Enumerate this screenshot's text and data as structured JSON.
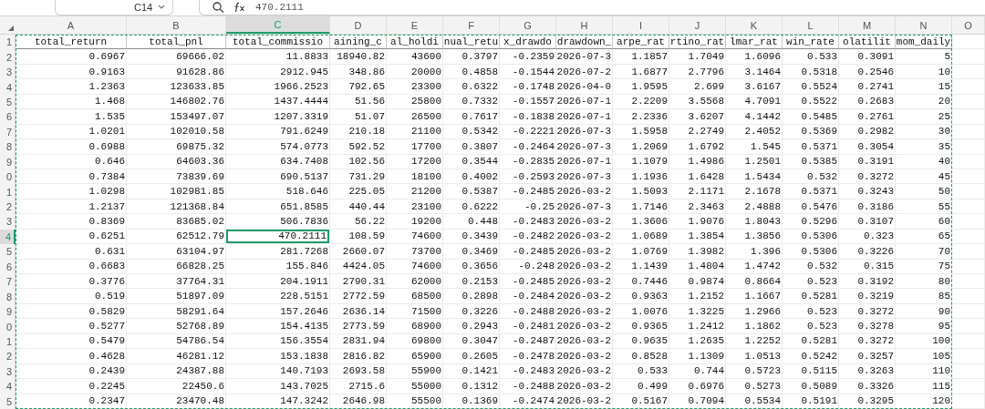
{
  "name_box": {
    "value": "C14"
  },
  "formula_bar": {
    "value": "470.2111"
  },
  "columns": [
    {
      "label": "A",
      "selected": false
    },
    {
      "label": "B",
      "selected": false
    },
    {
      "label": "C",
      "selected": true
    },
    {
      "label": "D",
      "selected": false
    },
    {
      "label": "E",
      "selected": false
    },
    {
      "label": "F",
      "selected": false
    },
    {
      "label": "G",
      "selected": false
    },
    {
      "label": "H",
      "selected": false
    },
    {
      "label": "I",
      "selected": false
    },
    {
      "label": "J",
      "selected": false
    },
    {
      "label": "K",
      "selected": false
    },
    {
      "label": "L",
      "selected": false
    },
    {
      "label": "M",
      "selected": false
    },
    {
      "label": "N",
      "selected": false
    },
    {
      "label": "O",
      "selected": false
    }
  ],
  "rows": [
    {
      "kind": "header",
      "label": "1",
      "selected": false,
      "cells": [
        "total_return",
        "total_pnl",
        "total_commissio",
        "aining_c",
        "al_holdi",
        "nual_retu",
        "x_drawdo",
        "drawdown_",
        "arpe_rat",
        "rtino_rat",
        "lmar_rat",
        "win_rate",
        "olatilit",
        "mom_daily"
      ]
    },
    {
      "kind": "data",
      "label": "2",
      "selected": false,
      "cells": [
        "0.6967",
        "69666.02",
        "11.8833",
        "18940.82",
        "43600",
        "0.3797",
        "-0.2359",
        "2026-07-3",
        "1.1857",
        "1.7049",
        "1.6096",
        "0.533",
        "0.3091",
        "5"
      ]
    },
    {
      "kind": "data",
      "label": "3",
      "selected": false,
      "cells": [
        "0.9163",
        "91628.86",
        "2912.945",
        "348.86",
        "20000",
        "0.4858",
        "-0.1544",
        "2026-07-2",
        "1.6877",
        "2.7796",
        "3.1464",
        "0.5318",
        "0.2546",
        "10"
      ]
    },
    {
      "kind": "data",
      "label": "4",
      "selected": false,
      "cells": [
        "1.2363",
        "123633.85",
        "1966.2523",
        "792.65",
        "23300",
        "0.6322",
        "-0.1748",
        "2026-04-0",
        "1.9595",
        "2.699",
        "3.6167",
        "0.5524",
        "0.2741",
        "15"
      ]
    },
    {
      "kind": "data",
      "label": "5",
      "selected": false,
      "cells": [
        "1.468",
        "146802.76",
        "1437.4444",
        "51.56",
        "25800",
        "0.7332",
        "-0.1557",
        "2026-07-1",
        "2.2209",
        "3.5568",
        "4.7091",
        "0.5522",
        "0.2683",
        "20"
      ]
    },
    {
      "kind": "data",
      "label": "6",
      "selected": false,
      "cells": [
        "1.535",
        "153497.07",
        "1207.3319",
        "51.07",
        "26500",
        "0.7617",
        "-0.1838",
        "2026-07-1",
        "2.2336",
        "3.6207",
        "4.1442",
        "0.5485",
        "0.2761",
        "25"
      ]
    },
    {
      "kind": "data",
      "label": "7",
      "selected": false,
      "cells": [
        "1.0201",
        "102010.58",
        "791.6249",
        "210.18",
        "21100",
        "0.5342",
        "-0.2221",
        "2026-07-3",
        "1.5958",
        "2.2749",
        "2.4052",
        "0.5369",
        "0.2982",
        "30"
      ]
    },
    {
      "kind": "data",
      "label": "8",
      "selected": false,
      "cells": [
        "0.6988",
        "69875.32",
        "574.0773",
        "592.52",
        "17700",
        "0.3807",
        "-0.2464",
        "2026-07-3",
        "1.2069",
        "1.6792",
        "1.545",
        "0.5371",
        "0.3054",
        "35"
      ]
    },
    {
      "kind": "data",
      "label": "9",
      "selected": false,
      "cells": [
        "0.646",
        "64603.36",
        "634.7408",
        "102.56",
        "17200",
        "0.3544",
        "-0.2835",
        "2026-07-1",
        "1.1079",
        "1.4986",
        "1.2501",
        "0.5385",
        "0.3191",
        "40"
      ]
    },
    {
      "kind": "data",
      "label": "0",
      "selected": false,
      "cells": [
        "0.7384",
        "73839.69",
        "690.5137",
        "731.29",
        "18100",
        "0.4002",
        "-0.2593",
        "2026-07-3",
        "1.1936",
        "1.6428",
        "1.5434",
        "0.532",
        "0.3272",
        "45"
      ]
    },
    {
      "kind": "data",
      "label": "1",
      "selected": false,
      "cells": [
        "1.0298",
        "102981.85",
        "518.646",
        "225.05",
        "21200",
        "0.5387",
        "-0.2485",
        "2026-03-2",
        "1.5093",
        "2.1171",
        "2.1678",
        "0.5371",
        "0.3243",
        "50"
      ]
    },
    {
      "kind": "data",
      "label": "2",
      "selected": false,
      "cells": [
        "1.2137",
        "121368.84",
        "651.8585",
        "440.44",
        "23100",
        "0.6222",
        "-0.25",
        "2026-07-3",
        "1.7146",
        "2.3463",
        "2.4888",
        "0.5476",
        "0.3186",
        "55"
      ]
    },
    {
      "kind": "data",
      "label": "3",
      "selected": false,
      "cells": [
        "0.8369",
        "83685.02",
        "506.7836",
        "56.22",
        "19200",
        "0.448",
        "-0.2483",
        "2026-03-2",
        "1.3606",
        "1.9076",
        "1.8043",
        "0.5296",
        "0.3107",
        "60"
      ]
    },
    {
      "kind": "data",
      "label": "4",
      "selected": true,
      "cells": [
        "0.6251",
        "62512.79",
        "470.2111",
        "108.59",
        "74600",
        "0.3439",
        "-0.2482",
        "2026-03-2",
        "1.0689",
        "1.3854",
        "1.3856",
        "0.5306",
        "0.323",
        "65"
      ]
    },
    {
      "kind": "data",
      "label": "5",
      "selected": false,
      "cells": [
        "0.631",
        "63104.97",
        "281.7268",
        "2660.07",
        "73700",
        "0.3469",
        "-0.2485",
        "2026-03-2",
        "1.0769",
        "1.3982",
        "1.396",
        "0.5306",
        "0.3226",
        "70"
      ]
    },
    {
      "kind": "data",
      "label": "6",
      "selected": false,
      "cells": [
        "0.6683",
        "66828.25",
        "155.846",
        "4424.05",
        "74600",
        "0.3656",
        "-0.248",
        "2026-03-2",
        "1.1439",
        "1.4804",
        "1.4742",
        "0.532",
        "0.315",
        "75"
      ]
    },
    {
      "kind": "data",
      "label": "7",
      "selected": false,
      "cells": [
        "0.3776",
        "37764.31",
        "204.1911",
        "2790.31",
        "62000",
        "0.2153",
        "-0.2485",
        "2026-03-2",
        "0.7446",
        "0.9874",
        "0.8664",
        "0.523",
        "0.3192",
        "80"
      ]
    },
    {
      "kind": "data",
      "label": "8",
      "selected": false,
      "cells": [
        "0.519",
        "51897.09",
        "228.5151",
        "2772.59",
        "68500",
        "0.2898",
        "-0.2484",
        "2026-03-2",
        "0.9363",
        "1.2152",
        "1.1667",
        "0.5281",
        "0.3219",
        "85"
      ]
    },
    {
      "kind": "data",
      "label": "9",
      "selected": false,
      "cells": [
        "0.5829",
        "58291.64",
        "157.2646",
        "2636.14",
        "71500",
        "0.3226",
        "-0.2488",
        "2026-03-2",
        "1.0076",
        "1.3225",
        "1.2966",
        "0.523",
        "0.3272",
        "90"
      ]
    },
    {
      "kind": "data",
      "label": "0",
      "selected": false,
      "cells": [
        "0.5277",
        "52768.89",
        "154.4135",
        "2773.59",
        "68900",
        "0.2943",
        "-0.2481",
        "2026-03-2",
        "0.9365",
        "1.2412",
        "1.1862",
        "0.523",
        "0.3278",
        "95"
      ]
    },
    {
      "kind": "data",
      "label": "1",
      "selected": false,
      "cells": [
        "0.5479",
        "54786.54",
        "156.3554",
        "2831.94",
        "69800",
        "0.3047",
        "-0.2487",
        "2026-03-2",
        "0.9635",
        "1.2635",
        "1.2252",
        "0.5281",
        "0.3272",
        "100"
      ]
    },
    {
      "kind": "data",
      "label": "2",
      "selected": false,
      "cells": [
        "0.4628",
        "46281.12",
        "153.1838",
        "2816.82",
        "65900",
        "0.2605",
        "-0.2478",
        "2026-03-2",
        "0.8528",
        "1.1309",
        "1.0513",
        "0.5242",
        "0.3257",
        "105"
      ]
    },
    {
      "kind": "data",
      "label": "3",
      "selected": false,
      "cells": [
        "0.2439",
        "24387.88",
        "140.7193",
        "2693.58",
        "55900",
        "0.1421",
        "-0.2483",
        "2026-03-2",
        "0.533",
        "0.744",
        "0.5723",
        "0.5115",
        "0.3263",
        "110"
      ]
    },
    {
      "kind": "data",
      "label": "4",
      "selected": false,
      "cells": [
        "0.2245",
        "22450.6",
        "143.7025",
        "2715.6",
        "55000",
        "0.1312",
        "-0.2488",
        "2026-03-2",
        "0.499",
        "0.6976",
        "0.5273",
        "0.5089",
        "0.3326",
        "115"
      ]
    },
    {
      "kind": "data",
      "label": "5",
      "selected": false,
      "cells": [
        "0.2347",
        "23470.48",
        "147.3242",
        "2646.98",
        "55500",
        "0.1369",
        "-0.2474",
        "2026-03-2",
        "0.5167",
        "0.7094",
        "0.5534",
        "0.5191",
        "0.3295",
        "120"
      ]
    }
  ]
}
